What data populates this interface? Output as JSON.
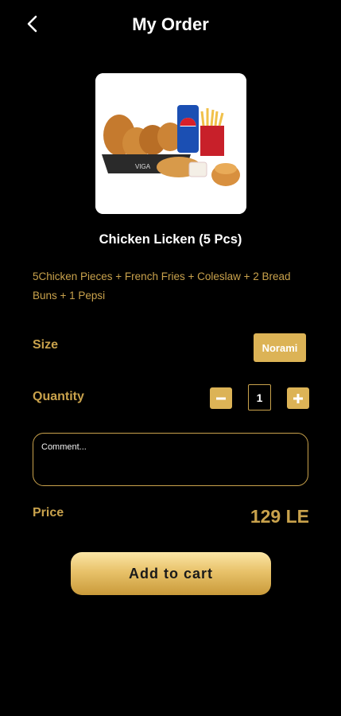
{
  "header": {
    "title": "My Order"
  },
  "product": {
    "name": "Chicken Licken (5 Pcs)",
    "description": "5Chicken Pieces + French Fries + Coleslaw + 2 Bread Buns + 1 Pepsi",
    "image_icon": "food-combo-image"
  },
  "size": {
    "label": "Size",
    "selected": "Norami"
  },
  "quantity": {
    "label": "Quantity",
    "value": "1"
  },
  "comment": {
    "placeholder": "Comment..."
  },
  "price": {
    "label": "Price",
    "value": "129 LE"
  },
  "cart": {
    "button_label": "Add to cart"
  },
  "colors": {
    "accent": "#c9a24c",
    "chip": "#dcb356",
    "background": "#000000"
  }
}
